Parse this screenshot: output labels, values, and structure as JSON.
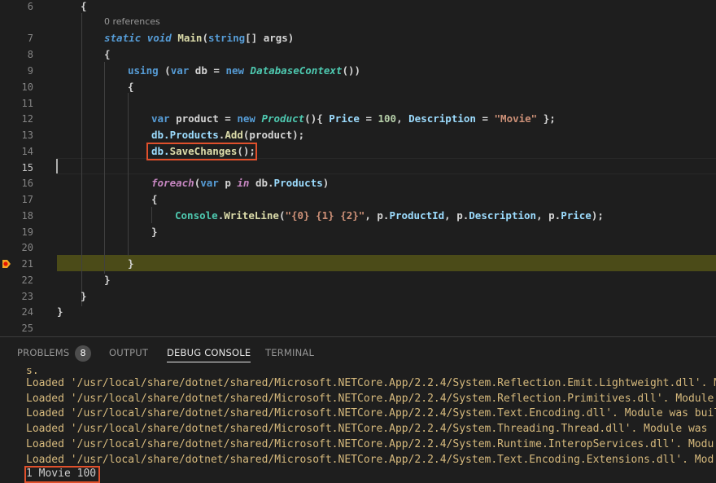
{
  "editor": {
    "codelens": "0 references",
    "lines": [
      {
        "n": "6"
      },
      {
        "n": "7"
      },
      {
        "n": "8"
      },
      {
        "n": "9"
      },
      {
        "n": "10"
      },
      {
        "n": "11"
      },
      {
        "n": "12"
      },
      {
        "n": "13"
      },
      {
        "n": "14"
      },
      {
        "n": "15"
      },
      {
        "n": "16"
      },
      {
        "n": "17"
      },
      {
        "n": "18"
      },
      {
        "n": "19"
      },
      {
        "n": "20"
      },
      {
        "n": "21"
      },
      {
        "n": "22"
      },
      {
        "n": "23"
      },
      {
        "n": "24"
      },
      {
        "n": "25"
      }
    ],
    "tokens": {
      "l6_brace": "{",
      "l7_static": "static",
      "l7_void": "void",
      "l7_main": "Main",
      "l7_open": "(",
      "l7_string": "string",
      "l7_args": "[] args)",
      "l8_brace": "{",
      "l9_using": "using",
      "l9_open": " (",
      "l9_var": "var",
      "l9_db": " db = ",
      "l9_new": "new",
      "l9_ctx": "DatabaseContext",
      "l9_close": "())",
      "l10_brace": "{",
      "l12_var": "var",
      "l12_product": " product = ",
      "l12_new": "new",
      "l12_cls": "Product",
      "l12_open": "(){ ",
      "l12_price": "Price",
      "l12_eq1": " = ",
      "l12_100": "100",
      "l12_comma": ", ",
      "l12_desc": "Description",
      "l12_eq2": " = ",
      "l12_movie": "\"Movie\"",
      "l12_end": " };",
      "l13_db": "db.",
      "l13_products": "Products",
      "l13_dot": ".",
      "l13_add": "Add",
      "l13_arg": "(product);",
      "l14_db": "db.",
      "l14_save": "SaveChanges",
      "l14_end": "();",
      "l16_foreach": "foreach",
      "l16_open": "(",
      "l16_var": "var",
      "l16_p": " p ",
      "l16_in": "in",
      "l16_db": " db.",
      "l16_products": "Products",
      "l16_close": ")",
      "l17_brace": "{",
      "l18_console": "Console",
      "l18_dot": ".",
      "l18_wl": "WriteLine",
      "l18_open": "(",
      "l18_fmt": "\"{0} {1} {2}\"",
      "l18_comma1": ", p.",
      "l18_pid": "ProductId",
      "l18_comma2": ", p.",
      "l18_desc": "Description",
      "l18_comma3": ", p.",
      "l18_price": "Price",
      "l18_end": ");",
      "l19_brace": "}",
      "l21_brace": "}",
      "l22_brace": "}",
      "l23_brace": "}",
      "l24_brace": "}"
    }
  },
  "panel": {
    "tabs": {
      "problems": "PROBLEMS",
      "problems_count": "8",
      "output": "OUTPUT",
      "debug_console": "DEBUG CONSOLE",
      "terminal": "TERMINAL"
    },
    "console_lines": [
      "s.",
      "Loaded '/usr/local/share/dotnet/shared/Microsoft.NETCore.App/2.2.4/System.Reflection.Emit.Lightweight.dll'. M",
      "Loaded '/usr/local/share/dotnet/shared/Microsoft.NETCore.App/2.2.4/System.Reflection.Primitives.dll'. Module",
      "Loaded '/usr/local/share/dotnet/shared/Microsoft.NETCore.App/2.2.4/System.Text.Encoding.dll'. Module was buil",
      "Loaded '/usr/local/share/dotnet/shared/Microsoft.NETCore.App/2.2.4/System.Threading.Thread.dll'. Module was",
      "Loaded '/usr/local/share/dotnet/shared/Microsoft.NETCore.App/2.2.4/System.Runtime.InteropServices.dll'. Modu",
      "Loaded '/usr/local/share/dotnet/shared/Microsoft.NETCore.App/2.2.4/System.Text.Encoding.Extensions.dll'. Mod"
    ],
    "program_output": "1 Movie 100"
  },
  "colors": {
    "editor_bg": "#1e1e1e",
    "paused_line": "#4b4b18",
    "breakpoint_arrow": "#f5a623",
    "highlight_box": "#e0502c",
    "console_loaded": "#d7ba7d"
  }
}
